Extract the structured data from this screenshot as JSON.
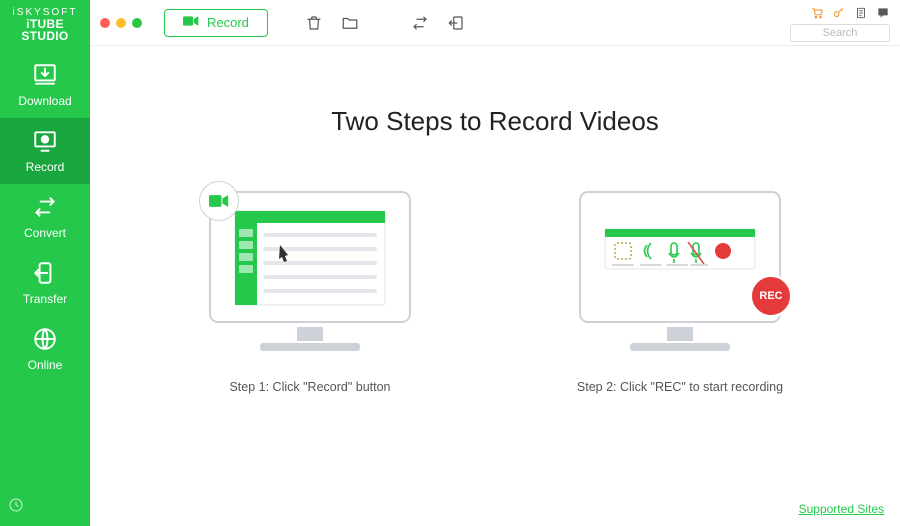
{
  "brand": {
    "line1": "iSKYSOFT",
    "line2": "iTUBE STUDIO"
  },
  "sidebar": {
    "items": [
      {
        "label": "Download"
      },
      {
        "label": "Record"
      },
      {
        "label": "Convert"
      },
      {
        "label": "Transfer"
      },
      {
        "label": "Online"
      }
    ]
  },
  "toolbar": {
    "record_label": "Record"
  },
  "search": {
    "placeholder": "Search"
  },
  "page": {
    "title": "Two Steps to Record Videos",
    "step1": "Step 1: Click \"Record\" button",
    "step2": "Step 2: Click \"REC\" to start recording",
    "rec_badge": "REC"
  },
  "footer": {
    "supported_sites": "Supported Sites"
  },
  "colors": {
    "accent": "#25c84a"
  }
}
